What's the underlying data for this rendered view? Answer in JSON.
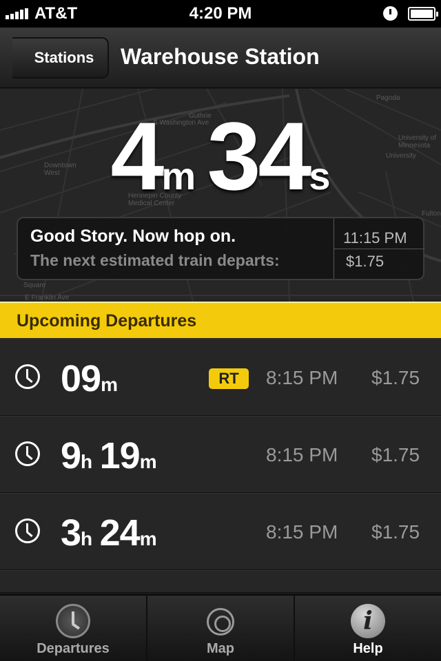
{
  "status_bar": {
    "carrier": "AT&T",
    "time": "4:20 PM"
  },
  "nav": {
    "back_label": "Stations",
    "title": "Warehouse Station"
  },
  "countdown": {
    "minutes": "4",
    "minutes_unit": "m",
    "seconds": "34",
    "seconds_unit": "s"
  },
  "info": {
    "message": "Good Story. Now hop on.",
    "subtext": "The next estimated train departs:",
    "time": "11:15 PM",
    "price": "$1.75"
  },
  "map_labels": {
    "downtown": "Downtown West",
    "university": "University",
    "u_of_mn": "University of Minnesota",
    "hennepin": "Hennepin County Medical Center",
    "pagoda": "Pagoda",
    "fulton": "Fulton",
    "square": "Square",
    "franklin": "E Franklin Ave",
    "washington": "S Washington Ave",
    "guthrie": "Guthrie"
  },
  "section": {
    "title": "Upcoming Departures"
  },
  "departures": [
    {
      "parts": [
        {
          "n": "09",
          "u": "m"
        }
      ],
      "badge": "RT",
      "time": "8:15 PM",
      "price": "$1.75"
    },
    {
      "parts": [
        {
          "n": "9",
          "u": "h"
        },
        {
          "n": "19",
          "u": "m"
        }
      ],
      "badge": "",
      "time": "8:15 PM",
      "price": "$1.75"
    },
    {
      "parts": [
        {
          "n": "3",
          "u": "h"
        },
        {
          "n": "24",
          "u": "m"
        }
      ],
      "badge": "",
      "time": "8:15 PM",
      "price": "$1.75"
    }
  ],
  "tabs": [
    {
      "label": "Departures",
      "icon": "clock-icon",
      "active": false
    },
    {
      "label": "Map",
      "icon": "crosshair-icon",
      "active": false
    },
    {
      "label": "Help",
      "icon": "info-icon",
      "active": true
    }
  ],
  "colors": {
    "accent": "#f3cb0c",
    "background": "#262626"
  }
}
